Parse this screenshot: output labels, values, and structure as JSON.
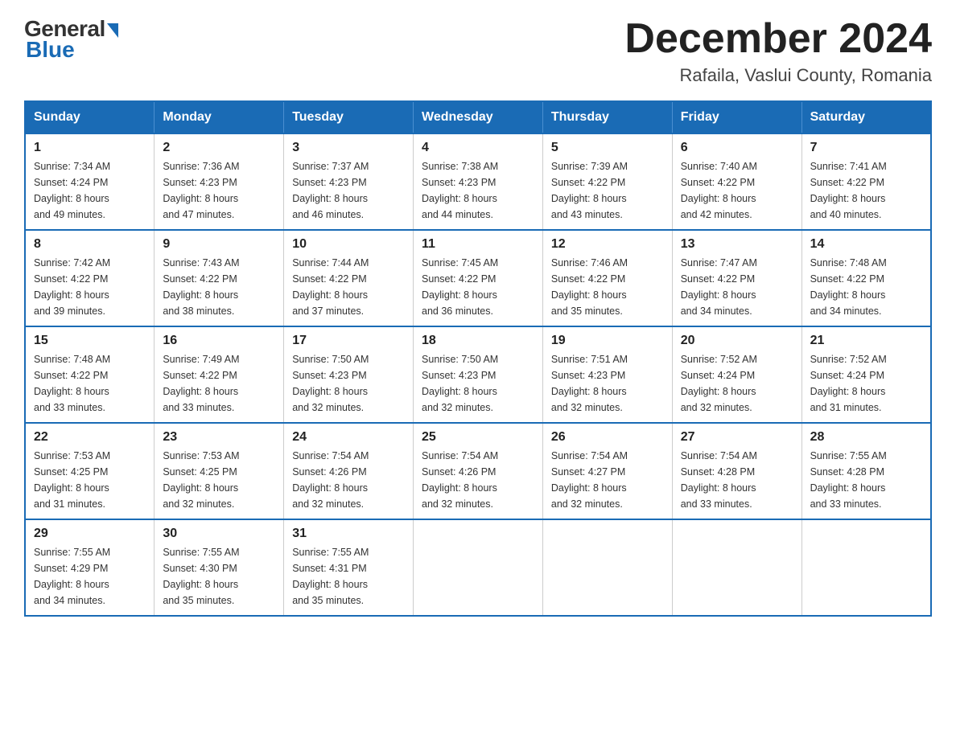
{
  "logo": {
    "general": "General",
    "blue": "Blue"
  },
  "title": {
    "month": "December 2024",
    "location": "Rafaila, Vaslui County, Romania"
  },
  "headers": [
    "Sunday",
    "Monday",
    "Tuesday",
    "Wednesday",
    "Thursday",
    "Friday",
    "Saturday"
  ],
  "weeks": [
    [
      {
        "day": "1",
        "sunrise": "7:34 AM",
        "sunset": "4:24 PM",
        "daylight": "8 hours and 49 minutes."
      },
      {
        "day": "2",
        "sunrise": "7:36 AM",
        "sunset": "4:23 PM",
        "daylight": "8 hours and 47 minutes."
      },
      {
        "day": "3",
        "sunrise": "7:37 AM",
        "sunset": "4:23 PM",
        "daylight": "8 hours and 46 minutes."
      },
      {
        "day": "4",
        "sunrise": "7:38 AM",
        "sunset": "4:23 PM",
        "daylight": "8 hours and 44 minutes."
      },
      {
        "day": "5",
        "sunrise": "7:39 AM",
        "sunset": "4:22 PM",
        "daylight": "8 hours and 43 minutes."
      },
      {
        "day": "6",
        "sunrise": "7:40 AM",
        "sunset": "4:22 PM",
        "daylight": "8 hours and 42 minutes."
      },
      {
        "day": "7",
        "sunrise": "7:41 AM",
        "sunset": "4:22 PM",
        "daylight": "8 hours and 40 minutes."
      }
    ],
    [
      {
        "day": "8",
        "sunrise": "7:42 AM",
        "sunset": "4:22 PM",
        "daylight": "8 hours and 39 minutes."
      },
      {
        "day": "9",
        "sunrise": "7:43 AM",
        "sunset": "4:22 PM",
        "daylight": "8 hours and 38 minutes."
      },
      {
        "day": "10",
        "sunrise": "7:44 AM",
        "sunset": "4:22 PM",
        "daylight": "8 hours and 37 minutes."
      },
      {
        "day": "11",
        "sunrise": "7:45 AM",
        "sunset": "4:22 PM",
        "daylight": "8 hours and 36 minutes."
      },
      {
        "day": "12",
        "sunrise": "7:46 AM",
        "sunset": "4:22 PM",
        "daylight": "8 hours and 35 minutes."
      },
      {
        "day": "13",
        "sunrise": "7:47 AM",
        "sunset": "4:22 PM",
        "daylight": "8 hours and 34 minutes."
      },
      {
        "day": "14",
        "sunrise": "7:48 AM",
        "sunset": "4:22 PM",
        "daylight": "8 hours and 34 minutes."
      }
    ],
    [
      {
        "day": "15",
        "sunrise": "7:48 AM",
        "sunset": "4:22 PM",
        "daylight": "8 hours and 33 minutes."
      },
      {
        "day": "16",
        "sunrise": "7:49 AM",
        "sunset": "4:22 PM",
        "daylight": "8 hours and 33 minutes."
      },
      {
        "day": "17",
        "sunrise": "7:50 AM",
        "sunset": "4:23 PM",
        "daylight": "8 hours and 32 minutes."
      },
      {
        "day": "18",
        "sunrise": "7:50 AM",
        "sunset": "4:23 PM",
        "daylight": "8 hours and 32 minutes."
      },
      {
        "day": "19",
        "sunrise": "7:51 AM",
        "sunset": "4:23 PM",
        "daylight": "8 hours and 32 minutes."
      },
      {
        "day": "20",
        "sunrise": "7:52 AM",
        "sunset": "4:24 PM",
        "daylight": "8 hours and 32 minutes."
      },
      {
        "day": "21",
        "sunrise": "7:52 AM",
        "sunset": "4:24 PM",
        "daylight": "8 hours and 31 minutes."
      }
    ],
    [
      {
        "day": "22",
        "sunrise": "7:53 AM",
        "sunset": "4:25 PM",
        "daylight": "8 hours and 31 minutes."
      },
      {
        "day": "23",
        "sunrise": "7:53 AM",
        "sunset": "4:25 PM",
        "daylight": "8 hours and 32 minutes."
      },
      {
        "day": "24",
        "sunrise": "7:54 AM",
        "sunset": "4:26 PM",
        "daylight": "8 hours and 32 minutes."
      },
      {
        "day": "25",
        "sunrise": "7:54 AM",
        "sunset": "4:26 PM",
        "daylight": "8 hours and 32 minutes."
      },
      {
        "day": "26",
        "sunrise": "7:54 AM",
        "sunset": "4:27 PM",
        "daylight": "8 hours and 32 minutes."
      },
      {
        "day": "27",
        "sunrise": "7:54 AM",
        "sunset": "4:28 PM",
        "daylight": "8 hours and 33 minutes."
      },
      {
        "day": "28",
        "sunrise": "7:55 AM",
        "sunset": "4:28 PM",
        "daylight": "8 hours and 33 minutes."
      }
    ],
    [
      {
        "day": "29",
        "sunrise": "7:55 AM",
        "sunset": "4:29 PM",
        "daylight": "8 hours and 34 minutes."
      },
      {
        "day": "30",
        "sunrise": "7:55 AM",
        "sunset": "4:30 PM",
        "daylight": "8 hours and 35 minutes."
      },
      {
        "day": "31",
        "sunrise": "7:55 AM",
        "sunset": "4:31 PM",
        "daylight": "8 hours and 35 minutes."
      },
      null,
      null,
      null,
      null
    ]
  ],
  "labels": {
    "sunrise": "Sunrise:",
    "sunset": "Sunset:",
    "daylight": "Daylight:"
  }
}
